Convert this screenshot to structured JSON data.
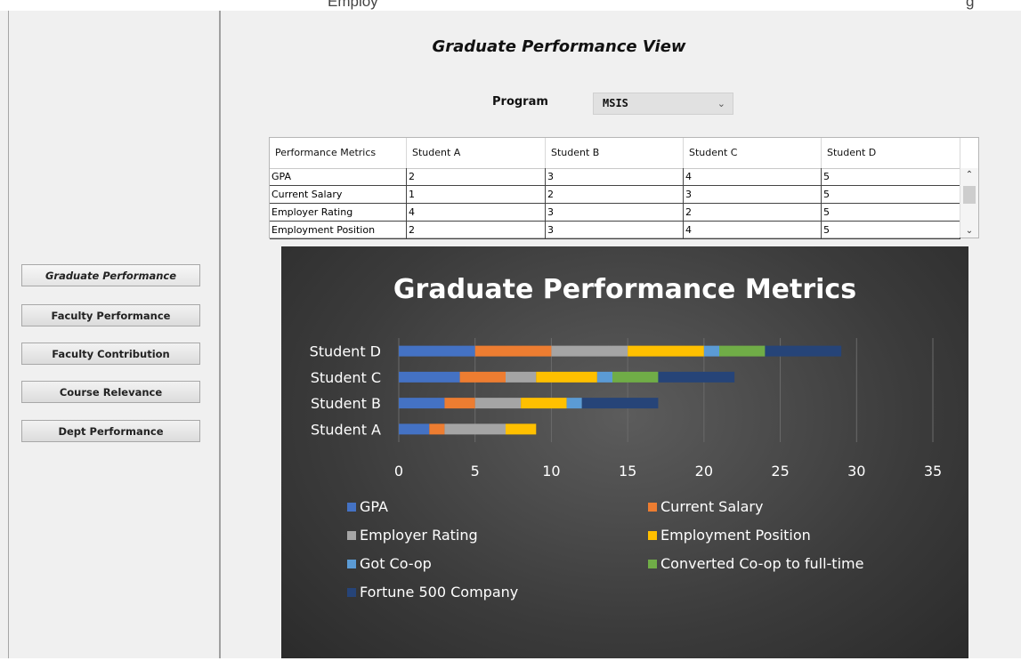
{
  "top_strip": {
    "text_a": "Employ",
    "text_b": "g"
  },
  "sidebar": {
    "buttons": [
      {
        "label": "Graduate Performance"
      },
      {
        "label": "Faculty Performance"
      },
      {
        "label": "Faculty Contribution"
      },
      {
        "label": "Course Relevance"
      },
      {
        "label": "Dept Performance"
      }
    ],
    "active_index": 0
  },
  "main": {
    "title": "Graduate Performance View",
    "program": {
      "label": "Program",
      "value": "MSIS"
    },
    "table": {
      "headers": [
        "Performance Metrics",
        "Student A",
        "Student B",
        "Student C",
        "Student D"
      ],
      "rows": [
        [
          "GPA",
          "2",
          "3",
          "4",
          "5"
        ],
        [
          "Current Salary",
          "1",
          "2",
          "3",
          "5"
        ],
        [
          "Employer Rating",
          "4",
          "3",
          "2",
          "5"
        ],
        [
          "Employment Position",
          "2",
          "3",
          "4",
          "5"
        ]
      ]
    }
  },
  "chart_data": {
    "type": "bar",
    "orientation": "horizontal",
    "stacked": true,
    "title": "Graduate Performance Metrics",
    "categories": [
      "Student A",
      "Student B",
      "Student C",
      "Student D"
    ],
    "series": [
      {
        "name": "GPA",
        "values": [
          2,
          3,
          4,
          5
        ],
        "color": "#4472C4"
      },
      {
        "name": "Current Salary",
        "values": [
          1,
          2,
          3,
          5
        ],
        "color": "#ED7D31"
      },
      {
        "name": "Employer Rating",
        "values": [
          4,
          3,
          2,
          5
        ],
        "color": "#A5A5A5"
      },
      {
        "name": "Employment Position",
        "values": [
          2,
          3,
          4,
          5
        ],
        "color": "#FFC000"
      },
      {
        "name": "Got Co-op",
        "values": [
          0,
          1,
          1,
          1
        ],
        "color": "#5B9BD5"
      },
      {
        "name": "Converted Co-op to full-time",
        "values": [
          0,
          0,
          3,
          3
        ],
        "color": "#70AD47"
      },
      {
        "name": "Fortune 500 Company",
        "values": [
          0,
          5,
          5,
          5
        ],
        "color": "#264478"
      }
    ],
    "xlim": [
      0,
      35
    ],
    "xticks": [
      0,
      5,
      10,
      15,
      20,
      25,
      30,
      35
    ],
    "grid": true,
    "legend_position": "bottom",
    "background": "#3f3f3f"
  },
  "colors": {
    "window_bg": "#f0f0f0",
    "chart_text": "#ffffff",
    "chart_gridline": "#6a6a6a"
  }
}
